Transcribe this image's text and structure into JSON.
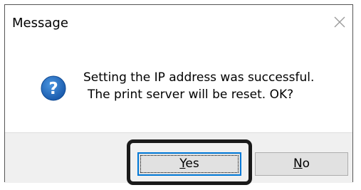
{
  "window": {
    "title": "Message",
    "close_icon": "close-icon"
  },
  "message": {
    "icon": "question-icon",
    "line1": "Setting the IP address was successful.",
    "line2": "The print server will be reset. OK?"
  },
  "buttons": {
    "yes_mnemonic": "Y",
    "yes_rest": "es",
    "no_mnemonic": "N",
    "no_rest": "o"
  },
  "colors": {
    "accent": "#0078d7",
    "icon_blue": "#1f6fc5",
    "highlight_frame": "#1a1a1a"
  }
}
